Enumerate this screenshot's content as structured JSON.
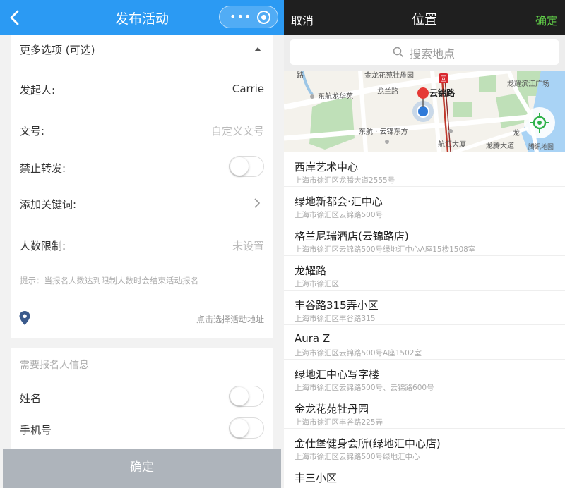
{
  "left": {
    "nav": {
      "title": "发布活动",
      "menu_icon": "dots-icon",
      "close_icon": "target-circle-icon"
    },
    "options": {
      "header": "更多选项 (可选)",
      "initiator_label": "发起人:",
      "initiator_value": "Carrie",
      "doc_label": "文号:",
      "doc_placeholder": "自定义文号",
      "forward_label": "禁止转发:",
      "keywords_label": "添加关键词:",
      "limit_label": "人数限制:",
      "limit_placeholder": "未设置",
      "hint": "提示：当报名人数达到限制人数时会结束活动报名",
      "address_placeholder": "点击选择活动地址"
    },
    "required": {
      "header": "需要报名人信息",
      "name_label": "姓名",
      "phone_label": "手机号"
    },
    "confirm": "确定"
  },
  "right": {
    "cancel": "取消",
    "title": "位置",
    "ok": "确定",
    "search_placeholder": "搜索地点",
    "map_labels": {
      "garden": "金龙花苑牡丹园",
      "east_air": "东航龙华苑",
      "longlan": "龙兰路",
      "yunjin": "云锦路",
      "binjiang": "龙耀滨江广场",
      "east_yunjin": "东航 · 云锦东方",
      "hanghui": "航汇大厦",
      "tengxun": "腾讯地图",
      "longteng": "龙腾大道",
      "loop_road": "路",
      "vert1": "龙",
      "vert2": "龙耀",
      "vert3": "大道",
      "metro": "回"
    },
    "places": [
      {
        "name": "西岸艺术中心",
        "address": "上海市徐汇区龙腾大道2555号"
      },
      {
        "name": "绿地新都会·汇中心",
        "address": "上海市徐汇区云锦路500号"
      },
      {
        "name": "格兰尼瑞酒店(云锦路店)",
        "address": "上海市徐汇区云锦路500号绿地汇中心A座15楼1508室"
      },
      {
        "name": "龙耀路",
        "address": "上海市徐汇区"
      },
      {
        "name": "丰谷路315弄小区",
        "address": "上海市徐汇区丰谷路315"
      },
      {
        "name": "Aura Z",
        "address": "上海市徐汇区云锦路500号A座1502室"
      },
      {
        "name": "绿地汇中心写字楼",
        "address": "上海市徐汇区云锦路500号、云锦路600号"
      },
      {
        "name": "金龙花苑牡丹园",
        "address": "上海市徐汇区丰谷路225弄"
      },
      {
        "name": "金仕堡健身会所(绿地汇中心店)",
        "address": "上海市徐汇区云锦路500号绿地汇中心"
      },
      {
        "name": "丰三小区",
        "address": ""
      }
    ]
  }
}
